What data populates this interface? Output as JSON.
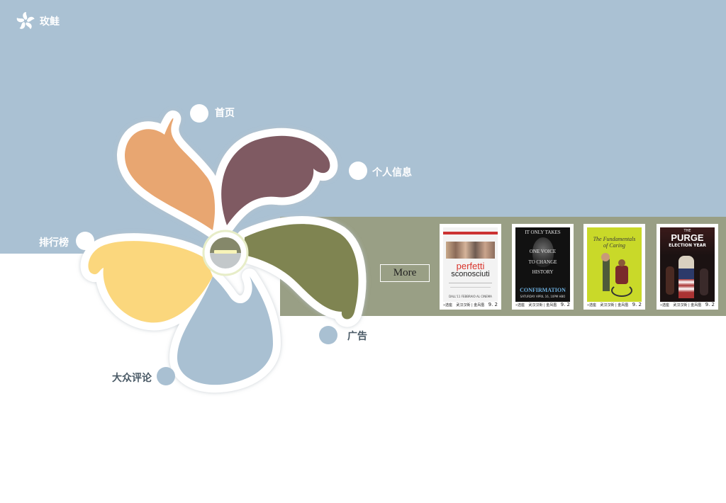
{
  "brand": {
    "name": "玫鲑",
    "logo_icon": "flower-logo-icon"
  },
  "nav": {
    "home": "首页",
    "profile": "个人信息",
    "ranking": "排行榜",
    "ads": "广告",
    "reviews": "大众评论"
  },
  "more_label": "More",
  "posters": [
    {
      "title_line1": "perfetti",
      "title_line2": "sconosciuti",
      "tagline": "DALL'11 FEBBRAIO AL CINEMA",
      "foot_left": "»选座",
      "foot_mid": "武汉汉街 | 金凤凰",
      "score": "9. 2"
    },
    {
      "title_line1": "IT ONLY TAKES",
      "title_line2": "ONE VOICE",
      "title_line3": "TO CHANGE",
      "title_line4": "HISTORY",
      "title_main": "CONFIRMATION",
      "subtitle": "SATURDAY APRIL 16, 10PM HBO",
      "foot_left": "»选座",
      "foot_mid": "武汉汉街 | 金凤凰",
      "score": "9. 2"
    },
    {
      "title_main": "The Fundamentals of Caring",
      "foot_left": "»选座",
      "foot_mid": "武汉汉街 | 金凤凰",
      "score": "9. 2"
    },
    {
      "title_line1": "THE",
      "title_main": "PURGE",
      "subtitle": "ELECTION YEAR",
      "foot_left": "»选座",
      "foot_mid": "武汉汉街 | 金凤凰",
      "score": "9. 2"
    }
  ],
  "colors": {
    "sky": "#aac1d3",
    "olive_band": "#999f85",
    "petal_orange": "#e8a671",
    "petal_plum": "#7f5a62",
    "petal_olive": "#7f8451",
    "petal_yellow": "#fbd77d",
    "petal_blue": "#a9c0d2"
  }
}
